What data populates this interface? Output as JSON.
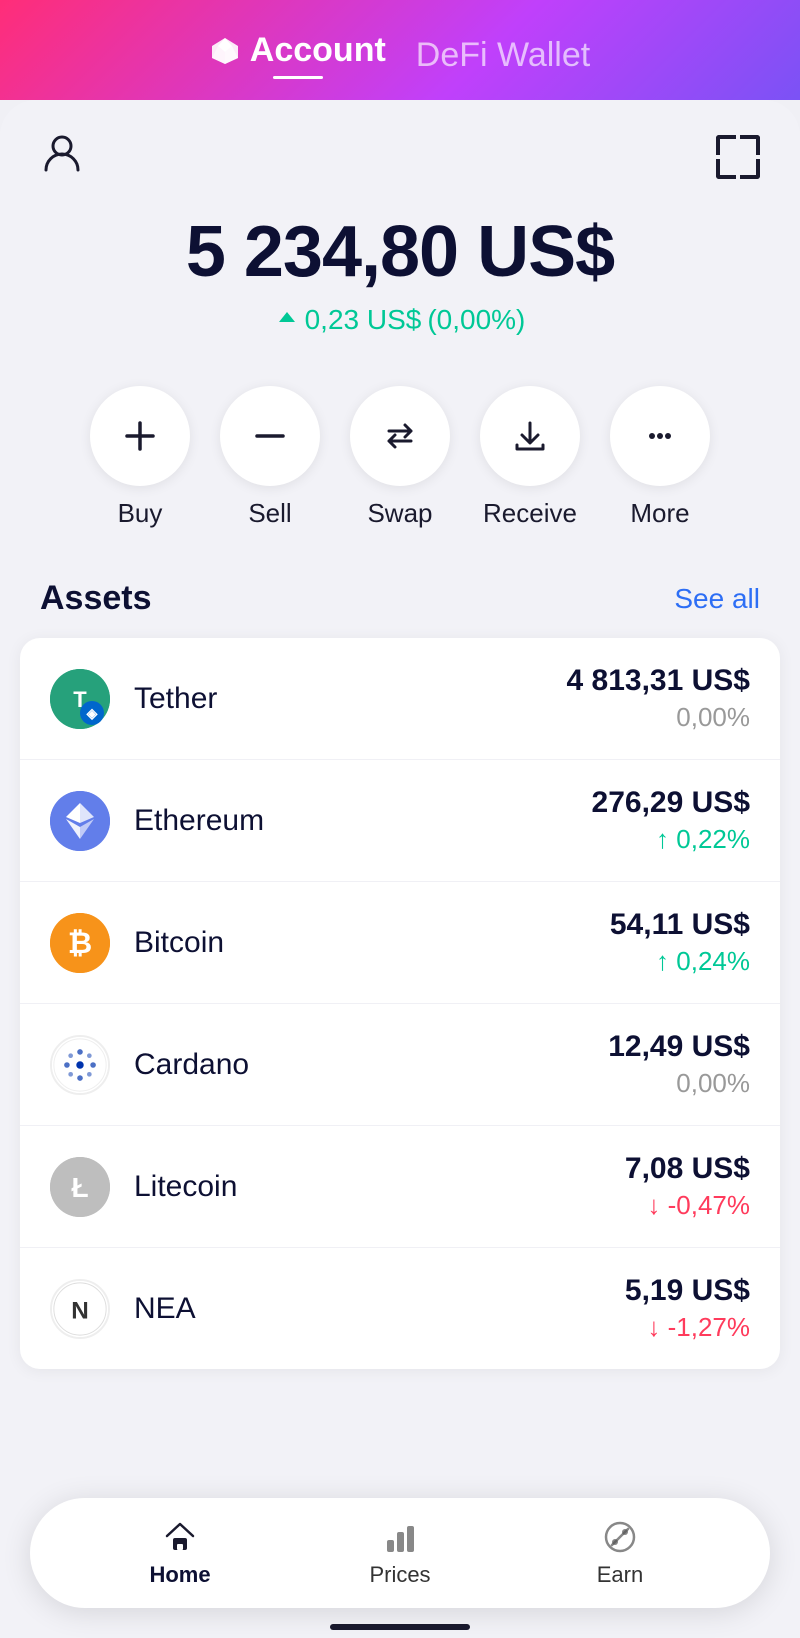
{
  "header": {
    "account_label": "Account",
    "defi_label": "DeFi Wallet",
    "gem_icon": "◆"
  },
  "balance": {
    "amount": "5 234,80 US$",
    "change_amount": "0,23 US$",
    "change_percent": "(0,00%)",
    "change_direction": "up"
  },
  "actions": [
    {
      "id": "buy",
      "label": "Buy",
      "icon": "plus"
    },
    {
      "id": "sell",
      "label": "Sell",
      "icon": "minus"
    },
    {
      "id": "swap",
      "label": "Swap",
      "icon": "swap"
    },
    {
      "id": "receive",
      "label": "Receive",
      "icon": "download"
    },
    {
      "id": "more",
      "label": "More",
      "icon": "ellipsis"
    }
  ],
  "assets_section": {
    "title": "Assets",
    "see_all": "See all"
  },
  "assets": [
    {
      "id": "tether",
      "name": "Tether",
      "amount": "4 813,31 US$",
      "change": "0,00%",
      "change_dir": "neutral",
      "color": "#26a17b",
      "symbol": "USDT"
    },
    {
      "id": "ethereum",
      "name": "Ethereum",
      "amount": "276,29 US$",
      "change": "↑ 0,22%",
      "change_dir": "up",
      "color": "#627eea",
      "symbol": "ETH"
    },
    {
      "id": "bitcoin",
      "name": "Bitcoin",
      "amount": "54,11 US$",
      "change": "↑ 0,24%",
      "change_dir": "up",
      "color": "#f7931a",
      "symbol": "BTC"
    },
    {
      "id": "cardano",
      "name": "Cardano",
      "amount": "12,49 US$",
      "change": "0,00%",
      "change_dir": "neutral",
      "color": "#0033ad",
      "symbol": "ADA"
    },
    {
      "id": "litecoin",
      "name": "Litecoin",
      "amount": "7,08 US$",
      "change": "↓ -0,47%",
      "change_dir": "down",
      "color": "#bebebe",
      "symbol": "LTC"
    },
    {
      "id": "nea",
      "name": "NEA",
      "amount": "5,19 US$",
      "change": "↓ -1,27%",
      "change_dir": "down",
      "color": "#333",
      "symbol": "N"
    }
  ],
  "bottom_nav": [
    {
      "id": "home",
      "label": "Home",
      "icon": "home",
      "active": true
    },
    {
      "id": "prices",
      "label": "Prices",
      "icon": "chart",
      "active": false
    },
    {
      "id": "earn",
      "label": "Earn",
      "icon": "percent",
      "active": false
    }
  ]
}
